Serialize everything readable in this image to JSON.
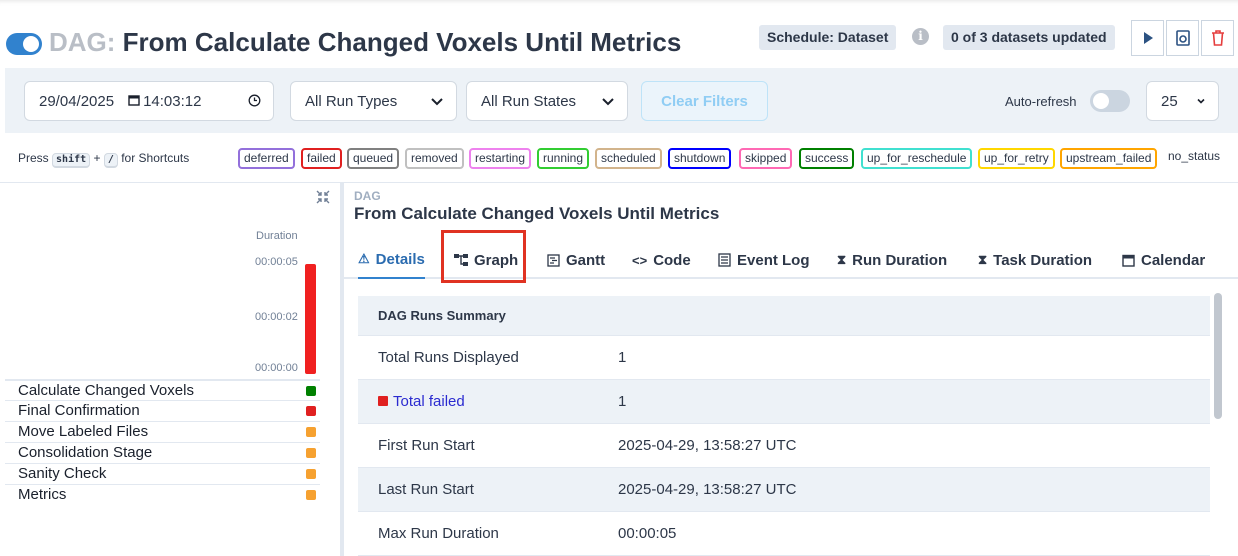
{
  "header": {
    "dag_prefix": "DAG:",
    "dag_name": "From Calculate Changed Voxels Until Metrics",
    "schedule_badge": "Schedule: Dataset",
    "datasets_badge": "0 of 3 datasets updated",
    "info_glyph": "i"
  },
  "filters": {
    "date_value": "29/04/2025",
    "time_value": "14:03:12",
    "run_types": "All Run Types",
    "run_states": "All Run States",
    "clear_label": "Clear Filters",
    "autorefresh_label": "Auto-refresh",
    "page_size": "25"
  },
  "shortcuts": {
    "press": "Press",
    "key1": "shift",
    "plus": "+",
    "key2": "/",
    "suffix": "for Shortcuts"
  },
  "legend": [
    {
      "label": "deferred",
      "color": "#9370db"
    },
    {
      "label": "failed",
      "color": "#e02020"
    },
    {
      "label": "queued",
      "color": "#808080"
    },
    {
      "label": "removed",
      "color": "#c0c0c0"
    },
    {
      "label": "restarting",
      "color": "#ee82ee"
    },
    {
      "label": "running",
      "color": "#32cd32"
    },
    {
      "label": "scheduled",
      "color": "#d2b48c"
    },
    {
      "label": "shutdown",
      "color": "#0000ff"
    },
    {
      "label": "skipped",
      "color": "#ff69b4"
    },
    {
      "label": "success",
      "color": "#008000"
    },
    {
      "label": "up_for_reschedule",
      "color": "#40e0d0"
    },
    {
      "label": "up_for_retry",
      "color": "#ffd700"
    },
    {
      "label": "upstream_failed",
      "color": "#ffa500"
    },
    {
      "label": "no_status",
      "color": ""
    }
  ],
  "grid": {
    "duration_label": "Duration",
    "ticks": [
      "00:00:05",
      "00:00:02",
      "00:00:00"
    ],
    "tasks": [
      {
        "name": "Calculate Changed Voxels",
        "color": "#008000"
      },
      {
        "name": "Final Confirmation",
        "color": "#e02020"
      },
      {
        "name": "Move Labeled Files",
        "color": "#f6a130"
      },
      {
        "name": "Consolidation Stage",
        "color": "#f6a130"
      },
      {
        "name": "Sanity Check",
        "color": "#f6a130"
      },
      {
        "name": "Metrics",
        "color": "#f6a130"
      }
    ]
  },
  "detail": {
    "small_label": "DAG",
    "dag_name": "From Calculate Changed Voxels Until Metrics",
    "tabs": [
      "Details",
      "Graph",
      "Gantt",
      "Code",
      "Event Log",
      "Run Duration",
      "Task Duration",
      "Calendar"
    ],
    "summary_title": "DAG Runs Summary",
    "rows": [
      {
        "k": "Total Runs Displayed",
        "v": "1"
      },
      {
        "k": "Total failed",
        "v": "1"
      },
      {
        "k": "First Run Start",
        "v": "2025-04-29, 13:58:27 UTC"
      },
      {
        "k": "Last Run Start",
        "v": "2025-04-29, 13:58:27 UTC"
      },
      {
        "k": "Max Run Duration",
        "v": "00:00:05"
      }
    ]
  }
}
